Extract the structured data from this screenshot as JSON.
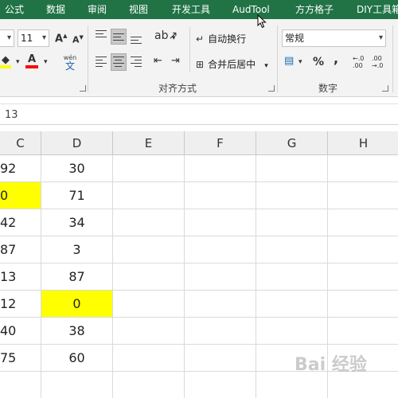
{
  "tabs": [
    "公式",
    "数据",
    "审阅",
    "视图",
    "开发工具",
    "AudTool",
    "方方格子",
    "DIY工具箱"
  ],
  "font": {
    "size": "11",
    "grow_label": "A",
    "shrink_label": "A",
    "font_color_label": "A",
    "phonetic_label": "wén",
    "phonetic_char": "文",
    "fill_color": "#ffff00",
    "font_color": "#ff0000"
  },
  "alignment": {
    "wrap_text_label": "自动换行",
    "merge_center_label": "合并后居中",
    "group_label": "对齐方式"
  },
  "number": {
    "format_value": "常规",
    "percent_label": "%",
    "comma_label": ",",
    "group_label": "数字",
    "inc_decimal_label": "←.0\n.00",
    "dec_decimal_label": ".00\n→.0"
  },
  "formula_bar": {
    "value": "13"
  },
  "columns": [
    "C",
    "D",
    "E",
    "F",
    "G",
    "H"
  ],
  "rows": [
    {
      "c": "92",
      "d": "30"
    },
    {
      "c": "0",
      "d": "71"
    },
    {
      "c": "42",
      "d": "34"
    },
    {
      "c": "87",
      "d": "3"
    },
    {
      "c": "13",
      "d": "87"
    },
    {
      "c": "12",
      "d": "0"
    },
    {
      "c": "40",
      "d": "38"
    },
    {
      "c": "75",
      "d": "60"
    },
    {
      "c": "",
      "d": ""
    }
  ],
  "highlight_color": "#ffff00",
  "watermark": "Bai 经验"
}
